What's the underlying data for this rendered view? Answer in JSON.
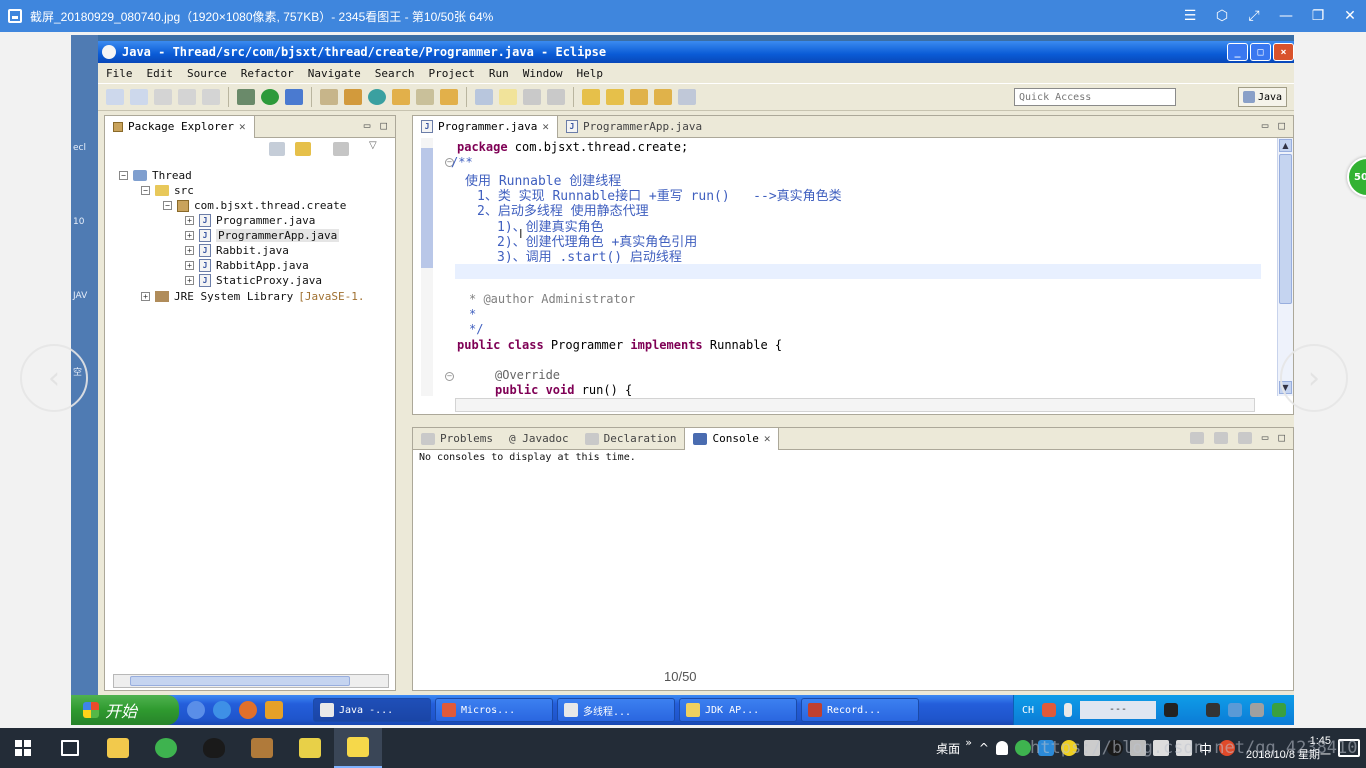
{
  "viewer": {
    "title": "截屏_20180929_080740.jpg（1920×1080像素, 757KB）- 2345看图王 - 第10/50张 64%",
    "controls": [
      "☰",
      "⬡",
      "⤢",
      "—",
      "❐",
      "✕"
    ],
    "page_counter": "10/50",
    "badge": "50",
    "prev_arrow": "‹",
    "next_arrow": "›"
  },
  "desktop": {
    "side_texts": [
      "ecl",
      "10",
      "JAV",
      "空"
    ]
  },
  "eclipse": {
    "title": "Java - Thread/src/com/bjsxt/thread/create/Programmer.java - Eclipse",
    "menu": [
      "File",
      "Edit",
      "Source",
      "Refactor",
      "Navigate",
      "Search",
      "Project",
      "Run",
      "Window",
      "Help"
    ],
    "quick_access_placeholder": "Quick Access",
    "perspective": "Java",
    "package_explorer": {
      "tab_label": "Package Explorer",
      "tree": {
        "project": "Thread",
        "src": "src",
        "package": "com.bjsxt.thread.create",
        "files": [
          "Programmer.java",
          "ProgrammerApp.java",
          "Rabbit.java",
          "RabbitApp.java",
          "StaticProxy.java"
        ],
        "library": "JRE System Library",
        "library_version": "[JavaSE-1."
      }
    },
    "editor": {
      "tabs": [
        "Programmer.java",
        "ProgrammerApp.java"
      ],
      "code": {
        "l1_kw": "package",
        "l1_rest": " com.bjsxt.thread.create;",
        "l2": "/**",
        "l3": "使用 Runnable 创建线程",
        "l4": "1、类 实现 Runnable接口 +重写 run()   -->真实角色类",
        "l5": "2、启动多线程 使用静态代理",
        "l6": "1)、创建真实角色",
        "l7": "2)、创建代理角色 +真实角色引用",
        "l8": "3)、调用 .start() 启动线程",
        "l9": "* @author Administrator",
        "l10": "*",
        "l11": "*/",
        "l12_kw1": "public class",
        "l12_mid": " Programmer ",
        "l12_kw2": "implements",
        "l12_rest": " Runnable {",
        "l13": "@Override",
        "l14_kw": "public void",
        "l14_rest": " run() {"
      }
    },
    "bottom_tabs": [
      "Problems",
      "@ Javadoc",
      "Declaration",
      "Console"
    ],
    "console_message": "No consoles to display at this time."
  },
  "xp_taskbar": {
    "start": "开始",
    "tasks": [
      "Java -...",
      "Micros...",
      "多线程...",
      "JDK AP...",
      "Record..."
    ],
    "tray_lang": "CH",
    "tray_box": "---"
  },
  "win_taskbar": {
    "desktop": "桌面",
    "overflow": "»",
    "ime": "中",
    "time": "1:45",
    "date": "2018/10/8 星期一",
    "watermark": "https://blog.csdn.net/qq_4238410"
  }
}
